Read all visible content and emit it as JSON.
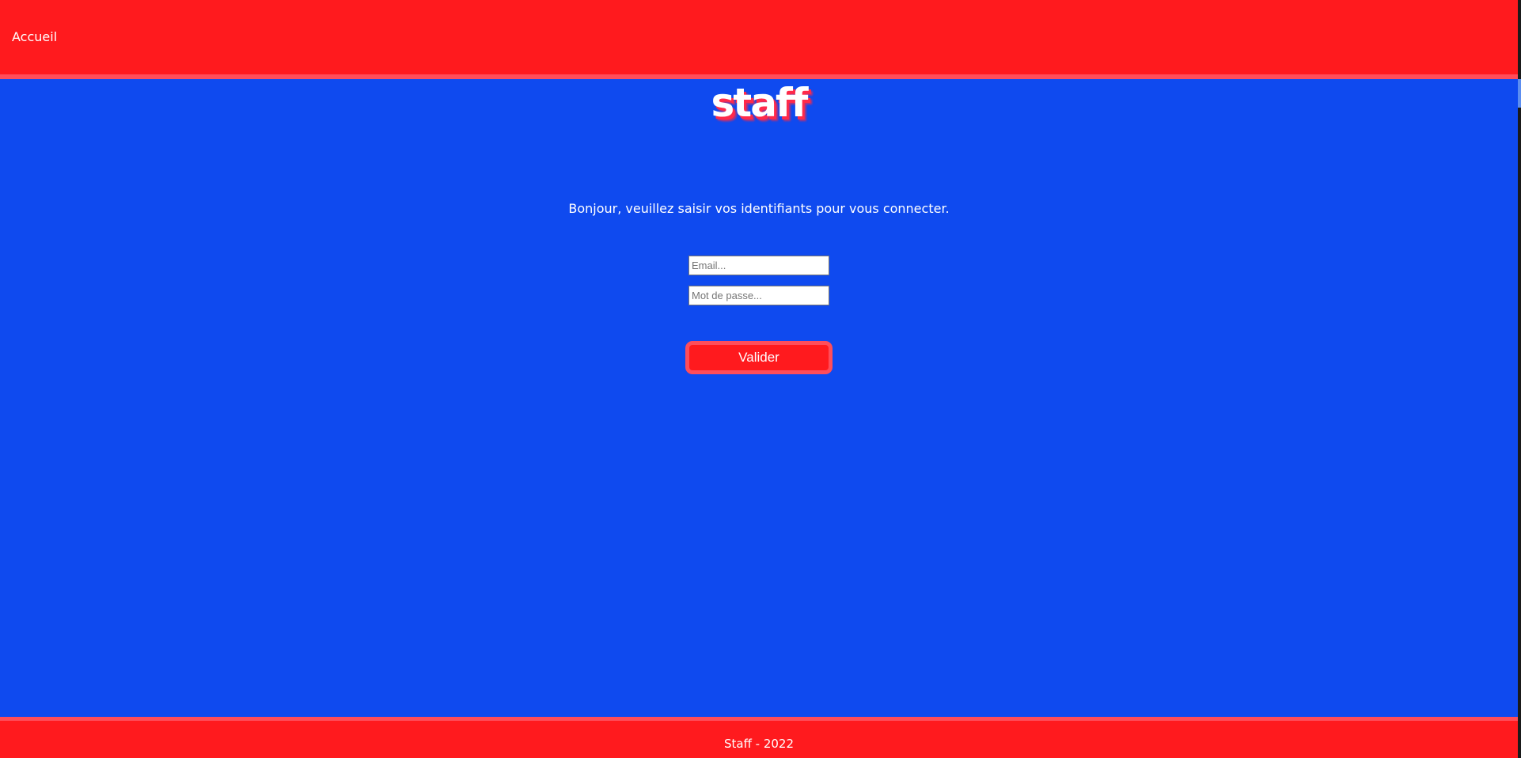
{
  "header": {
    "nav_home_label": "Accueil"
  },
  "logo": {
    "text": "staff"
  },
  "login": {
    "intro_text": "Bonjour, veuillez saisir vos identifiants pour vous connecter.",
    "email_placeholder": "Email...",
    "email_value": "",
    "password_placeholder": "Mot de passe...",
    "password_value": "",
    "submit_label": "Valider"
  },
  "footer": {
    "text": "Staff - 2022"
  },
  "colors": {
    "background": "#0f4aef",
    "header_footer": "#ff1a1e",
    "accent_border": "#ff4d5a",
    "text": "#ffffff"
  }
}
